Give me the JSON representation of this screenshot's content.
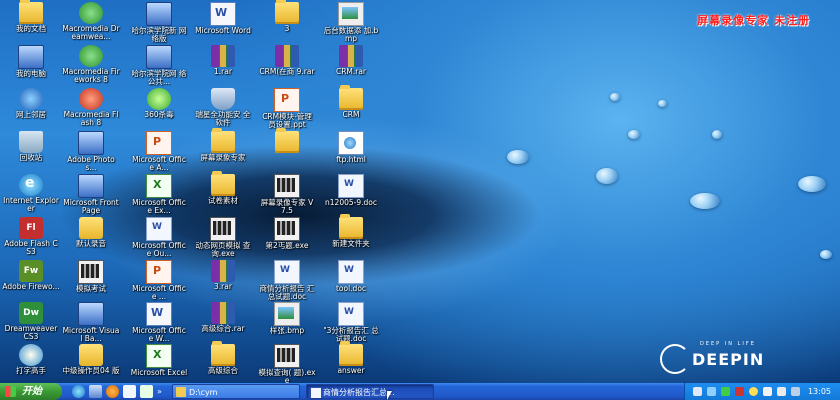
{
  "watermark": "屏幕录像专家  未注册",
  "logo": {
    "tagline": "DEEP IN LIFE",
    "brand": "DEEPIN"
  },
  "desktop_icons": [
    {
      "label": "我的文档",
      "icon": "folder-icon"
    },
    {
      "label": "Macromedia Dreamwea...",
      "icon": "dreamweaver-icon"
    },
    {
      "label": "哈尔滨学院新 网络版",
      "icon": "computer-icon"
    },
    {
      "label": "Microsoft Word",
      "icon": "word-icon"
    },
    {
      "label": "3",
      "icon": "folder-icon"
    },
    {
      "label": "后台数据添 加.bmp",
      "icon": "bitmap-icon"
    },
    {
      "label": "我的电脑",
      "icon": "computer-icon"
    },
    {
      "label": "Macromedia Fireworks 8",
      "icon": "fireworks-icon"
    },
    {
      "label": "哈尔滨学院网 络公共...",
      "icon": "computer-icon"
    },
    {
      "label": "1.rar",
      "icon": "rar-icon"
    },
    {
      "label": "CRM(在商 9.rar",
      "icon": "rar-icon"
    },
    {
      "label": "CRM.rar",
      "icon": "rar-icon"
    },
    {
      "label": "网上邻居",
      "icon": "network-icon"
    },
    {
      "label": "Macromedia Flash 8",
      "icon": "flash-icon"
    },
    {
      "label": "360杀毒",
      "icon": "antivirus-icon"
    },
    {
      "label": "瑞星全功能安 全软件",
      "icon": "shield-icon"
    },
    {
      "label": "CRM模块-管理 员设置.ppt",
      "icon": "powerpoint-icon"
    },
    {
      "label": "CRM",
      "icon": "folder-icon"
    },
    {
      "label": "回收站",
      "icon": "recycle-bin-icon"
    },
    {
      "label": "Adobe Photos...",
      "icon": "photoshop-icon"
    },
    {
      "label": "Microsoft Office A...",
      "icon": "access-icon"
    },
    {
      "label": "屏幕录象专家",
      "icon": "folder-icon"
    },
    {
      "label": "",
      "icon": "folder-icon"
    },
    {
      "label": "ftp.html",
      "icon": "html-icon"
    },
    {
      "label": "Internet Explorer",
      "icon": "internet-explorer-icon"
    },
    {
      "label": "Microsoft FrontPage",
      "icon": "frontpage-icon"
    },
    {
      "label": "Microsoft Office Ex...",
      "icon": "excel-icon"
    },
    {
      "label": "试卷素材",
      "icon": "folder-icon"
    },
    {
      "label": "屏幕录像专家 V7.5",
      "icon": "recorder-icon"
    },
    {
      "label": "n12005-9.doc",
      "icon": "document-icon"
    },
    {
      "label": "Adobe Flash CS3",
      "icon": "flash-cs3-icon"
    },
    {
      "label": "默认录音",
      "icon": "audio-icon"
    },
    {
      "label": "Microsoft Office Ou...",
      "icon": "outlook-icon"
    },
    {
      "label": "动态网页模拟 查询.exe",
      "icon": "recorder-icon"
    },
    {
      "label": "第2丐题.exe",
      "icon": "recorder-icon"
    },
    {
      "label": "新建文件夹",
      "icon": "folder-icon"
    },
    {
      "label": "Adobe Firewo...",
      "icon": "fireworks-cs3-icon"
    },
    {
      "label": "模拟考试",
      "icon": "exam-icon"
    },
    {
      "label": "Microsoft Office ...",
      "icon": "powerpoint-icon"
    },
    {
      "label": "3.rar",
      "icon": "rar-icon"
    },
    {
      "label": "商情分析报告 汇总试题.doc",
      "icon": "document-icon"
    },
    {
      "label": "tool.doc",
      "icon": "document-icon"
    },
    {
      "label": "Dreamweaver CS3",
      "icon": "dreamweaver-cs3-icon"
    },
    {
      "label": "Microsoft Visual Ba...",
      "icon": "visual-basic-icon"
    },
    {
      "label": "Microsoft Office W...",
      "icon": "word-icon"
    },
    {
      "label": "高级综合.rar",
      "icon": "rar-icon"
    },
    {
      "label": "样张.bmp",
      "icon": "bitmap-icon"
    },
    {
      "label": "\"3分析报告汇 总试题.doc",
      "icon": "document-icon"
    },
    {
      "label": "打字高手",
      "icon": "typing-icon"
    },
    {
      "label": "中级操作员04 版",
      "icon": "tool-icon"
    },
    {
      "label": "Microsoft Excel",
      "icon": "excel-icon"
    },
    {
      "label": "高级综合",
      "icon": "folder-icon"
    },
    {
      "label": "模拟查询( 题).exe",
      "icon": "recorder-icon"
    },
    {
      "label": "answer",
      "icon": "folder-icon"
    }
  ],
  "taskbar": {
    "start_label": "开始",
    "tasks": [
      {
        "label": "D:\\cym",
        "icon": "folder-icon",
        "active": false
      },
      {
        "label": "商情分析报告汇总...",
        "icon": "word-icon",
        "active": true
      }
    ],
    "clock": "13:05"
  },
  "colors": {
    "watermark": "#ff2020",
    "taskbar": "#2158c8",
    "start_button": "#3a9b34",
    "tray": "#137ad8"
  }
}
